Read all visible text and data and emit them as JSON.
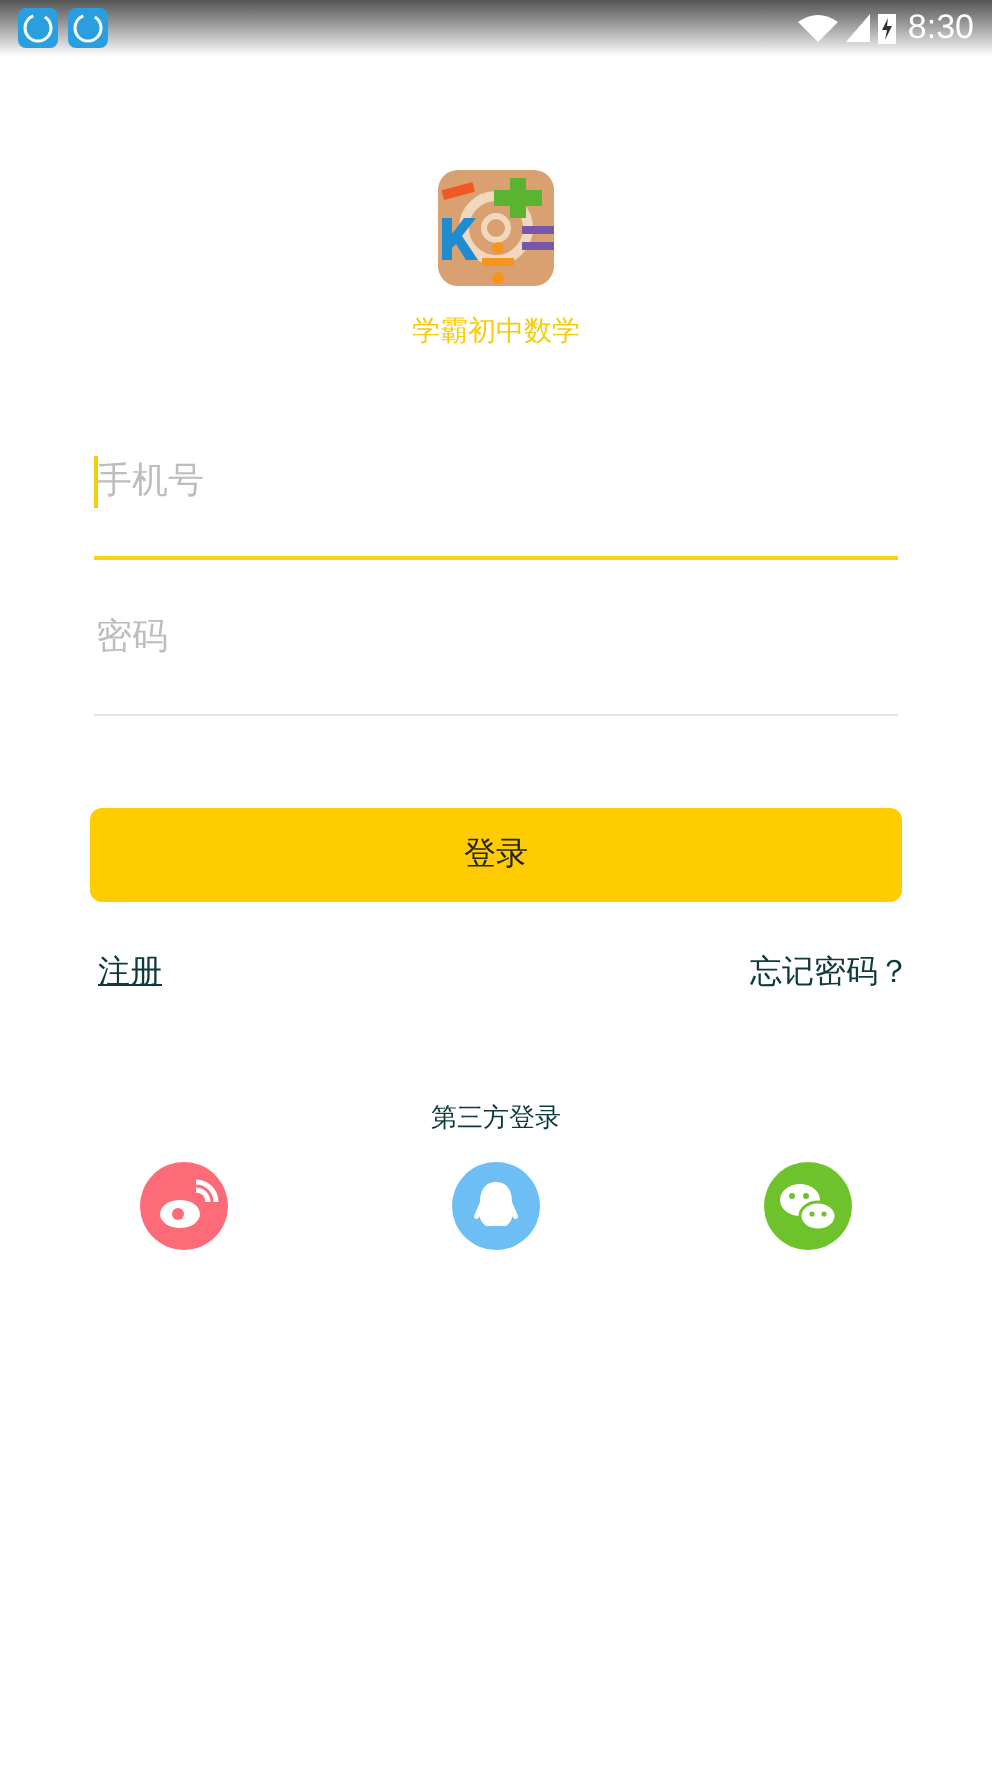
{
  "status_bar": {
    "time": "8:30",
    "notification_icons": [
      {
        "kind": "app"
      },
      {
        "kind": "app"
      }
    ]
  },
  "app": {
    "title": "学霸初中数学"
  },
  "fields": [
    {
      "placeholder": "手机号",
      "focused": true
    },
    {
      "placeholder": "密码",
      "focused": false
    }
  ],
  "login_button": "登录",
  "links": {
    "register": "注册",
    "forgot": "忘记密码？"
  },
  "third_party": {
    "label": "第三方登录",
    "providers": [
      {
        "kind": "weibo",
        "color": "#fd6a78"
      },
      {
        "kind": "qq",
        "color": "#6cbef5"
      },
      {
        "kind": "wechat",
        "color": "#6ec32c"
      }
    ]
  }
}
